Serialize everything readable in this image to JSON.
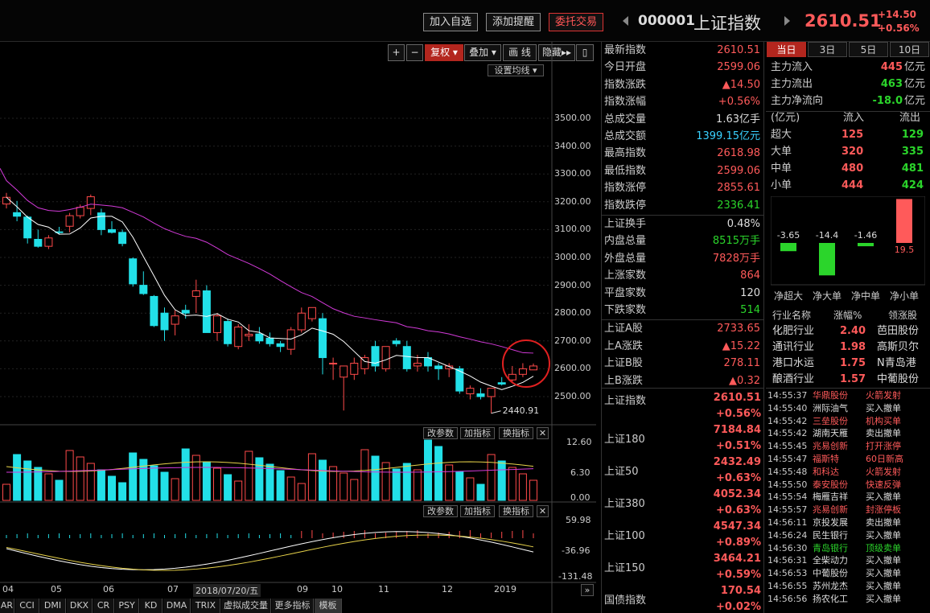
{
  "header": {
    "btn_add_watch": "加入自选",
    "btn_add_alert": "添加提醒",
    "btn_trade": "委托交易",
    "code": "000001",
    "name": "上证指数",
    "price": "2610.51",
    "change": "+14.50",
    "change_pct": "+0.56%"
  },
  "toolbar": {
    "plus": "+",
    "minus": "−",
    "fuquan": "复权",
    "diejia": "叠加",
    "draw": "画 线",
    "hide": "隐藏",
    "ma_setting": "设置均线"
  },
  "kline": {
    "y_ticks": [
      "3500.00",
      "3400.00",
      "3300.00",
      "3200.00",
      "3100.00",
      "3000.00",
      "2900.00",
      "2800.00",
      "2700.00",
      "2600.00",
      "2500.00"
    ],
    "low_label": "2440.91",
    "candles": [
      [
        3192,
        3232,
        3176,
        3216
      ],
      [
        3161,
        3203,
        3130,
        3148
      ],
      [
        3145,
        3150,
        3050,
        3070
      ],
      [
        3065,
        3100,
        3035,
        3040
      ],
      [
        3040,
        3080,
        3030,
        3070
      ],
      [
        3092,
        3110,
        3082,
        3090
      ],
      [
        3112,
        3160,
        3090,
        3150
      ],
      [
        3150,
        3190,
        3140,
        3180
      ],
      [
        3176,
        3226,
        3152,
        3218
      ],
      [
        3160,
        3175,
        3080,
        3100
      ],
      [
        3100,
        3130,
        3086,
        3090
      ],
      [
        3090,
        3100,
        3040,
        3050
      ],
      [
        2995,
        3000,
        2895,
        2905
      ],
      [
        2900,
        2950,
        2865,
        2870
      ],
      [
        2860,
        2865,
        2750,
        2755
      ],
      [
        2800,
        2820,
        2700,
        2740
      ],
      [
        2760,
        2810,
        2720,
        2790
      ],
      [
        2810,
        2830,
        2780,
        2800
      ],
      [
        2860,
        2920,
        2800,
        2880
      ],
      [
        2880,
        2900,
        2730,
        2730
      ],
      [
        2730,
        2800,
        2700,
        2790
      ],
      [
        2770,
        2780,
        2680,
        2690
      ],
      [
        2680,
        2760,
        2670,
        2750
      ],
      [
        2718,
        2760,
        2700,
        2724
      ],
      [
        2725,
        2750,
        2690,
        2700
      ],
      [
        2710,
        2730,
        2680,
        2690
      ],
      [
        2690,
        2700,
        2660,
        2680
      ],
      [
        2670,
        2750,
        2650,
        2740
      ],
      [
        2740,
        2820,
        2730,
        2800
      ],
      [
        2780,
        2810,
        2770,
        2820
      ],
      [
        2780,
        2800,
        2580,
        2640
      ],
      [
        2620,
        2640,
        2560,
        2620
      ],
      [
        2570,
        2600,
        2450,
        2610
      ],
      [
        2580,
        2640,
        2560,
        2620
      ],
      [
        2600,
        2650,
        2580,
        2640
      ],
      [
        2680,
        2700,
        2590,
        2610
      ],
      [
        2600,
        2680,
        2590,
        2680
      ],
      [
        2700,
        2710,
        2680,
        2690
      ],
      [
        2680,
        2700,
        2590,
        2600
      ],
      [
        2610,
        2650,
        2590,
        2620
      ],
      [
        2640,
        2660,
        2590,
        2610
      ],
      [
        2610,
        2620,
        2560,
        2600
      ],
      [
        2600,
        2620,
        2570,
        2610
      ],
      [
        2600,
        2610,
        2510,
        2520
      ],
      [
        2510,
        2540,
        2490,
        2530
      ],
      [
        2510,
        2530,
        2490,
        2500
      ],
      [
        2500,
        2530,
        2440,
        2530
      ],
      [
        2550,
        2570,
        2540,
        2545
      ],
      [
        2560,
        2610,
        2550,
        2580
      ],
      [
        2580,
        2620,
        2570,
        2600
      ],
      [
        2596,
        2619,
        2599,
        2610
      ]
    ]
  },
  "volume": {
    "buttons": [
      "改参数",
      "加指标",
      "换指标"
    ],
    "y_ticks": [
      "12.60",
      "6.30",
      "0.00"
    ]
  },
  "macd": {
    "buttons": [
      "改参数",
      "加指标",
      "换指标"
    ],
    "y_ticks": [
      "59.98",
      "-36.96",
      "-131.48"
    ]
  },
  "xaxis": {
    "labels": [
      "04",
      "05",
      "06",
      "07",
      "2018/07/20/五",
      "09",
      "10",
      "11",
      "12",
      "2019"
    ]
  },
  "bottom_tabs": [
    "AR",
    "CCI",
    "DMI",
    "DKX",
    "CR",
    "PSY",
    "KD",
    "DMA",
    "TRIX",
    "虚拟成交量",
    "更多指标",
    "模板"
  ],
  "quote": {
    "rows": [
      {
        "label": "最新指数",
        "value": "2610.51",
        "cls": "red"
      },
      {
        "label": "今日开盘",
        "value": "2599.06",
        "cls": "red"
      },
      {
        "label": "指数涨跌",
        "value": "▲14.50",
        "cls": "red"
      },
      {
        "label": "指数涨幅",
        "value": "+0.56%",
        "cls": "red"
      },
      {
        "label": "总成交量",
        "value": "1.63亿手",
        "cls": "white"
      },
      {
        "label": "总成交额",
        "value": "1399.15亿元",
        "cls": "cyan"
      },
      {
        "label": "最高指数",
        "value": "2618.98",
        "cls": "red"
      },
      {
        "label": "最低指数",
        "value": "2599.06",
        "cls": "red"
      },
      {
        "label": "指数涨停",
        "value": "2855.61",
        "cls": "red"
      },
      {
        "label": "指数跌停",
        "value": "2336.41",
        "cls": "green"
      },
      {
        "label": "上证换手",
        "value": "0.48%",
        "cls": "white"
      },
      {
        "label": "内盘总量",
        "value": "8515万手",
        "cls": "green"
      },
      {
        "label": "外盘总量",
        "value": "7828万手",
        "cls": "red"
      },
      {
        "label": "上涨家数",
        "value": "864",
        "cls": "red"
      },
      {
        "label": "平盘家数",
        "value": "120",
        "cls": "white"
      },
      {
        "label": "下跌家数",
        "value": "514",
        "cls": "green"
      },
      {
        "label": "上证A股",
        "value": "2733.65",
        "cls": "red"
      },
      {
        "label": "上A涨跌",
        "value": "▲15.22",
        "cls": "red"
      },
      {
        "label": "上证B股",
        "value": "278.11",
        "cls": "red"
      },
      {
        "label": "上B涨跌",
        "value": "▲0.32",
        "cls": "red"
      }
    ],
    "indices": [
      {
        "label": "上证指数",
        "value": "2610.51",
        "pct": "+0.56%"
      },
      {
        "label": "上证180",
        "value": "7184.84",
        "pct": "+0.51%"
      },
      {
        "label": "上证50",
        "value": "2432.49",
        "pct": "+0.63%"
      },
      {
        "label": "上证380",
        "value": "4052.34",
        "pct": "+0.63%"
      },
      {
        "label": "上证100",
        "value": "4547.34",
        "pct": "+0.89%"
      },
      {
        "label": "上证150",
        "value": "3464.21",
        "pct": "+0.59%"
      },
      {
        "label": "国债指数",
        "value": "170.54",
        "pct": "+0.02%"
      }
    ]
  },
  "right": {
    "tabs": [
      "当日",
      "3日",
      "5日",
      "10日"
    ],
    "flow": [
      {
        "label": "主力流入",
        "value": "445",
        "unit": "亿元",
        "cls": "red"
      },
      {
        "label": "主力流出",
        "value": "463",
        "unit": "亿元",
        "cls": "green"
      },
      {
        "label": "主力净流向",
        "value": "-18.0",
        "unit": "亿元",
        "cls": "green"
      }
    ],
    "flow_header": [
      "(亿元)",
      "流入",
      "流出"
    ],
    "flow_table": [
      {
        "label": "超大",
        "in": "125",
        "out": "129"
      },
      {
        "label": "大单",
        "in": "320",
        "out": "335"
      },
      {
        "label": "中单",
        "in": "480",
        "out": "481"
      },
      {
        "label": "小单",
        "in": "444",
        "out": "424"
      }
    ],
    "net_bars": [
      {
        "label": "净超大",
        "value": -3.65,
        "text": "-3.65"
      },
      {
        "label": "净大单",
        "value": -14.4,
        "text": "-14.4"
      },
      {
        "label": "净中单",
        "value": -1.46,
        "text": "-1.46"
      },
      {
        "label": "净小单",
        "value": 19.5,
        "text": "19.5"
      }
    ],
    "ind_header": [
      "行业名称",
      "涨幅%",
      "领涨股"
    ],
    "industries": [
      {
        "name": "化肥行业",
        "pct": "2.40",
        "lead": "芭田股份"
      },
      {
        "name": "通讯行业",
        "pct": "1.98",
        "lead": "高斯贝尔"
      },
      {
        "name": "港口水运",
        "pct": "1.75",
        "lead": "N青岛港"
      },
      {
        "name": "酿酒行业",
        "pct": "1.57",
        "lead": "中葡股份"
      }
    ],
    "ticks": [
      {
        "time": "14:55:37",
        "stock": "华鼎股份",
        "action": "火箭发射",
        "cls": "red"
      },
      {
        "time": "14:55:40",
        "stock": "洲际油气",
        "action": "买入撤单",
        "cls": "white"
      },
      {
        "time": "14:55:42",
        "stock": "三垒股份",
        "action": "机构买单",
        "cls": "red"
      },
      {
        "time": "14:55:42",
        "stock": "湖南天雁",
        "action": "卖出撤单",
        "cls": "white"
      },
      {
        "time": "14:55:45",
        "stock": "兆易创新",
        "action": "打开涨停",
        "cls": "red"
      },
      {
        "time": "14:55:47",
        "stock": "福斯特",
        "action": "60日新高",
        "cls": "red"
      },
      {
        "time": "14:55:48",
        "stock": "和科达",
        "action": "火箭发射",
        "cls": "red"
      },
      {
        "time": "14:55:50",
        "stock": "泰安股份",
        "action": "快速反弹",
        "cls": "red"
      },
      {
        "time": "14:55:54",
        "stock": "梅雁吉祥",
        "action": "买入撤单",
        "cls": "white"
      },
      {
        "time": "14:55:57",
        "stock": "兆易创新",
        "action": "封涨停板",
        "cls": "red"
      },
      {
        "time": "14:56:11",
        "stock": "京投发展",
        "action": "卖出撤单",
        "cls": "white"
      },
      {
        "time": "14:56:24",
        "stock": "民生银行",
        "action": "买入撤单",
        "cls": "white"
      },
      {
        "time": "14:56:30",
        "stock": "青岛银行",
        "action": "顶级卖单",
        "cls": "green"
      },
      {
        "time": "14:56:31",
        "stock": "全柴动力",
        "action": "买入撤单",
        "cls": "white"
      },
      {
        "time": "14:56:53",
        "stock": "中葡股份",
        "action": "买入撤单",
        "cls": "white"
      },
      {
        "time": "14:56:55",
        "stock": "苏州龙杰",
        "action": "买入撤单",
        "cls": "white"
      },
      {
        "time": "14:56:56",
        "stock": "扬农化工",
        "action": "买入撤单",
        "cls": "white"
      }
    ]
  },
  "colors": {
    "up": "#ff4a4a",
    "down": "#22e0e8",
    "ma5": "#ffffff",
    "ma20": "#d23ad8",
    "accent": "#b3261e"
  }
}
